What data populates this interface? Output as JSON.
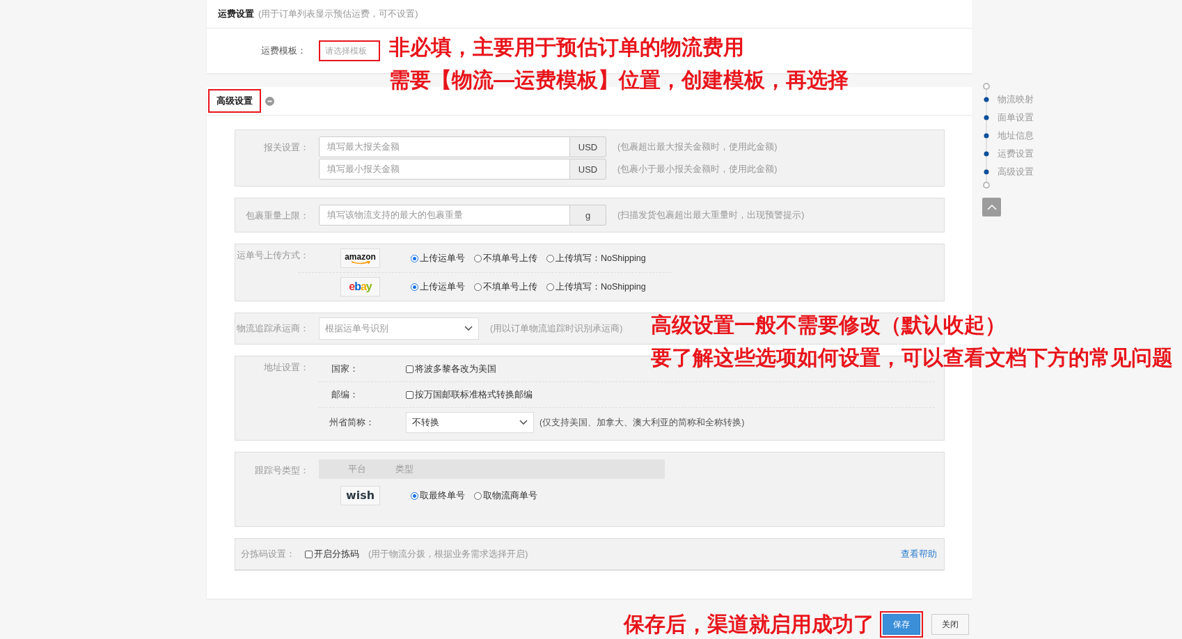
{
  "freight": {
    "title": "运费设置",
    "hint": "(用于订单列表显示预估运费，可不设置)",
    "template_label": "运费模板：",
    "template_placeholder": "请选择模板",
    "highlighted": true
  },
  "advanced": {
    "title": "高级设置",
    "expanded": true,
    "highlighted": true
  },
  "sections": [
    {
      "kind": "amounts",
      "label": "报关设置：",
      "rows": [
        {
          "placeholder": "填写最大报关金额",
          "unit": "USD",
          "hint": "(包裹超出最大报关金额时，使用此金额)"
        },
        {
          "placeholder": "填写最小报关金额",
          "unit": "USD",
          "hint": "(包裹小于最小报关金额时，使用此金额)"
        }
      ]
    },
    {
      "kind": "amounts",
      "label": "包裹重量上限：",
      "rows": [
        {
          "placeholder": "填写该物流支持的最大的包裹重量",
          "unit": "g",
          "hint": "(扫描发货包裹超出最大重量时，出现预警提示)"
        }
      ]
    },
    {
      "kind": "platforms",
      "label": "运单号上传方式：",
      "rows": [
        {
          "kind": "amazon",
          "logo": "amazon",
          "options": [
            {
              "label": "上传运单号",
              "selected": true
            },
            {
              "label": "不填单号上传",
              "selected": false
            },
            {
              "label": "上传填写：NoShipping",
              "selected": false
            }
          ]
        },
        {
          "kind": "ebay",
          "logo": "ebay",
          "options": [
            {
              "label": "上传运单号",
              "selected": true
            },
            {
              "label": "不填单号上传",
              "selected": false
            },
            {
              "label": "上传填写：NoShipping",
              "selected": false
            }
          ]
        }
      ]
    },
    {
      "kind": "select",
      "label": "物流追踪承运商：",
      "value": "根据运单号识别",
      "hint": "(用以订单物流追踪时识别承运商)"
    },
    {
      "kind": "address",
      "label": "地址设置：",
      "rows": [
        {
          "kind": "checkbox",
          "label": "国家：",
          "text": "将波多黎各改为美国",
          "checked": false
        },
        {
          "kind": "checkbox",
          "label": "邮编：",
          "text": "按万国邮联标准格式转换邮编",
          "checked": false
        },
        {
          "kind": "select",
          "label": "州省简称：",
          "value": "不转换",
          "hint": "(仅支持美国、加拿大、澳大利亚的简称和全称转换)"
        }
      ]
    },
    {
      "kind": "tracking",
      "label": "跟踪号类型：",
      "columns": [
        "平台",
        "类型"
      ],
      "rows": [
        {
          "kind": "wish",
          "logo": "wish",
          "options": [
            {
              "label": "取最终单号",
              "selected": true
            },
            {
              "label": "取物流商单号",
              "selected": false
            }
          ]
        }
      ]
    },
    {
      "kind": "sorting",
      "label": "分拣码设置：",
      "checkbox": {
        "text": "开启分拣码",
        "checked": false
      },
      "hint": "(用于物流分拨，根据业务需求选择开启)",
      "link": "查看帮助"
    }
  ],
  "nav": {
    "items": [
      "物流映射",
      "面单设置",
      "地址信息",
      "运费设置",
      "高级设置"
    ]
  },
  "footer_note": "保存后，渠道就启用成功了",
  "buttons": [
    {
      "label": "保存",
      "kind": "primary",
      "highlighted": true
    },
    {
      "label": "关闭",
      "kind": "default",
      "highlighted": false
    }
  ],
  "annotations": [
    "非必填，主要用于预估订单的物流费用",
    "需要【物流—运费模板】位置，创建模板，再选择",
    "高级设置一般不需要修改（默认收起）",
    "要了解这些选项如何设置，可以查看文档下方的常见问题"
  ]
}
